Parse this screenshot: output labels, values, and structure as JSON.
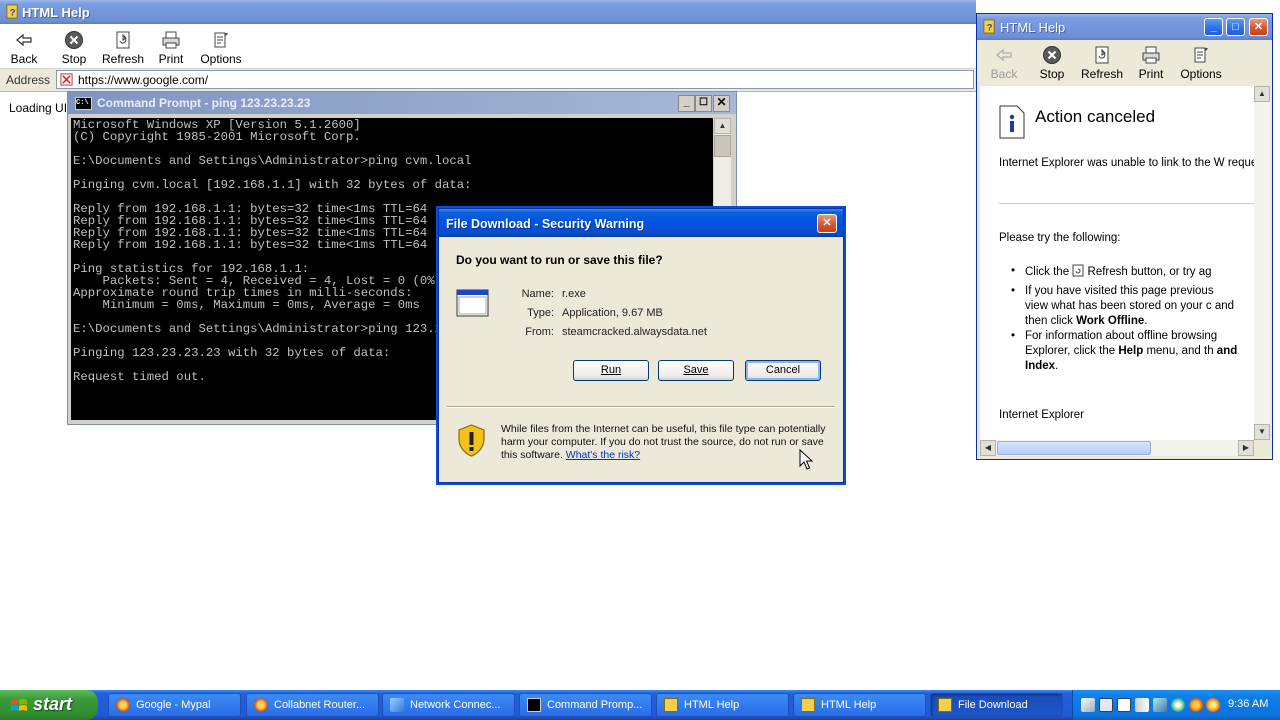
{
  "help_main": {
    "title": "HTML Help",
    "toolbar": {
      "back": "Back",
      "stop": "Stop",
      "refresh": "Refresh",
      "print": "Print",
      "options": "Options"
    },
    "address_label": "Address",
    "address_url": "https://www.google.com/",
    "loading_text": "Loading UI"
  },
  "cmd": {
    "title": "Command Prompt - ping 123.23.23.23",
    "lines": [
      "Microsoft Windows XP [Version 5.1.2600]",
      "(C) Copyright 1985-2001 Microsoft Corp.",
      "",
      "E:\\Documents and Settings\\Administrator>ping cvm.local",
      "",
      "Pinging cvm.local [192.168.1.1] with 32 bytes of data:",
      "",
      "Reply from 192.168.1.1: bytes=32 time<1ms TTL=64",
      "Reply from 192.168.1.1: bytes=32 time<1ms TTL=64",
      "Reply from 192.168.1.1: bytes=32 time<1ms TTL=64",
      "Reply from 192.168.1.1: bytes=32 time<1ms TTL=64",
      "",
      "Ping statistics for 192.168.1.1:",
      "    Packets: Sent = 4, Received = 4, Lost = 0 (0% loss),",
      "Approximate round trip times in milli-seconds:",
      "    Minimum = 0ms, Maximum = 0ms, Average = 0ms",
      "",
      "E:\\Documents and Settings\\Administrator>ping 123.23.23.23",
      "",
      "Pinging 123.23.23.23 with 32 bytes of data:",
      "",
      "Request timed out."
    ]
  },
  "dialog": {
    "title": "File Download - Security Warning",
    "question": "Do you want to run or save this file?",
    "name_label": "Name:",
    "name_value": "r.exe",
    "type_label": "Type:",
    "type_value": "Application, 9.67 MB",
    "from_label": "From:",
    "from_value": "steamcracked.alwaysdata.net",
    "run": "Run",
    "save": "Save",
    "cancel": "Cancel",
    "warning": "While files from the Internet can be useful, this file type can potentially harm your computer. If you do not trust the source, do not run or save this software.",
    "risk_link": "What's the risk?"
  },
  "help_side": {
    "title": "HTML Help",
    "toolbar": {
      "back": "Back",
      "stop": "Stop",
      "refresh": "Refresh",
      "print": "Print",
      "options": "Options"
    },
    "heading": "Action canceled",
    "para": "Internet Explorer was unable to link to the W requested. The page might be temporarily u",
    "try": "Please try the following:",
    "b1_pre": "Click the",
    "b1_post": "Refresh button, or try ag",
    "b2": "If you have visited this page previous view what has been stored on your c and then click",
    "b2_bold": "Work Offline",
    "b3": "For information about offline browsing Explorer, click the",
    "b3_bold1": "Help",
    "b3_mid": "menu, and th",
    "b3_bold2": "and Index",
    "footer": "Internet Explorer"
  },
  "taskbar": {
    "start": "start",
    "tasks": [
      "Google - Mypal",
      "Collabnet Router...",
      "Network Connec...",
      "Command Promp...",
      "HTML Help",
      "HTML Help",
      "File Download"
    ],
    "clock": "9:36 AM"
  }
}
